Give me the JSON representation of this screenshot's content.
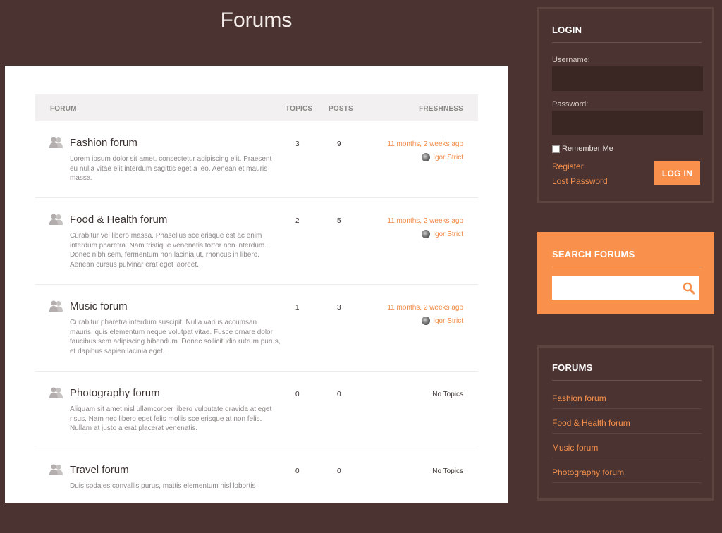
{
  "page": {
    "title": "Forums"
  },
  "table": {
    "headers": {
      "forum": "FORUM",
      "topics": "TOPICS",
      "posts": "POSTS",
      "freshness": "FRESHNESS"
    },
    "rows": [
      {
        "title": "Fashion forum",
        "description": "Lorem ipsum dolor sit amet, consectetur adipiscing elit. Praesent eu nulla vitae elit interdum sagittis eget a leo. Aenean et mauris massa.",
        "topics": "3",
        "posts": "9",
        "freshness": "11 months, 2 weeks ago",
        "author": "Igor Strict"
      },
      {
        "title": "Food & Health forum",
        "description": "Curabitur vel libero massa. Phasellus scelerisque est ac enim interdum pharetra. Nam tristique venenatis tortor non interdum. Donec nibh sem, fermentum non lacinia ut, rhoncus in libero. Aenean cursus pulvinar erat eget laoreet.",
        "topics": "2",
        "posts": "5",
        "freshness": "11 months, 2 weeks ago",
        "author": "Igor Strict"
      },
      {
        "title": "Music forum",
        "description": "Curabitur pharetra interdum suscipit. Nulla varius accumsan mauris, quis elementum neque volutpat vitae. Fusce ornare dolor faucibus sem adipiscing bibendum. Donec sollicitudin rutrum purus, et dapibus sapien lacinia eget.",
        "topics": "1",
        "posts": "3",
        "freshness": "11 months, 2 weeks ago",
        "author": "Igor Strict"
      },
      {
        "title": "Photography forum",
        "description": "Aliquam sit amet nisl ullamcorper libero vulputate gravida at eget risus. Nam nec libero eget felis mollis scelerisque at non felis. Nullam at justo a erat placerat venenatis.",
        "topics": "0",
        "posts": "0",
        "freshness": "No Topics"
      },
      {
        "title": "Travel forum",
        "description": "Duis sodales convallis purus, mattis elementum nisl lobortis",
        "topics": "0",
        "posts": "0",
        "freshness": "No Topics"
      }
    ]
  },
  "login": {
    "title": "LOGIN",
    "username_label": "Username:",
    "password_label": "Password:",
    "remember_label": "Remember Me",
    "register_link": "Register",
    "lost_password_link": "Lost Password",
    "button_label": "LOG IN"
  },
  "search": {
    "title": "SEARCH FORUMS",
    "placeholder": ""
  },
  "forums_widget": {
    "title": "FORUMS",
    "links": [
      "Fashion forum",
      "Food & Health forum",
      "Music forum",
      "Photography forum"
    ]
  },
  "colors": {
    "background": "#4a3330",
    "accent": "#f9914c",
    "panel": "#ffffff"
  }
}
